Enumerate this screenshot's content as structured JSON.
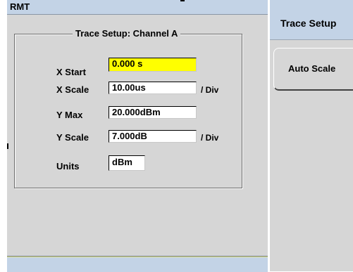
{
  "status_bar": {
    "label": "RMT"
  },
  "trace_setup": {
    "title": "Trace Setup: Channel A",
    "x_start": {
      "label": "X Start",
      "value": "0.000 s"
    },
    "x_scale": {
      "label": "X Scale",
      "value": "10.00us",
      "unit": "/ Div"
    },
    "y_max": {
      "label": "Y Max",
      "value": "20.000dBm"
    },
    "y_scale": {
      "label": "Y Scale",
      "value": "7.000dB",
      "unit": "/ Div"
    },
    "units": {
      "label": "Units",
      "value": "dBm"
    }
  },
  "softkeys": {
    "title": "Trace Setup",
    "auto_scale": "Auto Scale"
  },
  "colors": {
    "active_field": "#ffff00",
    "status_bar": "#c3d3e6",
    "panel": "#d6d6d6"
  }
}
